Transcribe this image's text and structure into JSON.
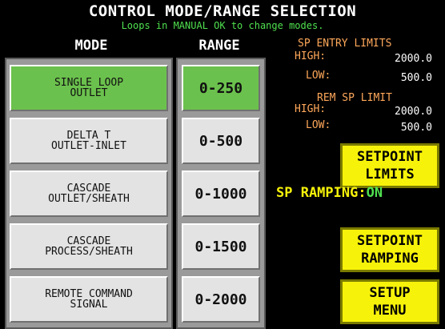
{
  "header": {
    "title": "CONTROL MODE/RANGE SELECTION",
    "subtitle": "Loops in MANUAL OK to change modes."
  },
  "columns": {
    "mode": "MODE",
    "range": "RANGE"
  },
  "modes": [
    {
      "label": "SINGLE LOOP\nOUTLET",
      "active": true
    },
    {
      "label": "DELTA T\nOUTLET-INLET",
      "active": false
    },
    {
      "label": "CASCADE\nOUTLET/SHEATH",
      "active": false
    },
    {
      "label": "CASCADE\nPROCESS/SHEATH",
      "active": false
    },
    {
      "label": "REMOTE COMMAND\nSIGNAL",
      "active": false
    }
  ],
  "ranges": [
    {
      "label": "0-250",
      "active": true
    },
    {
      "label": "0-500",
      "active": false
    },
    {
      "label": "0-1000",
      "active": false
    },
    {
      "label": "0-1500",
      "active": false
    },
    {
      "label": "0-2000",
      "active": false
    }
  ],
  "sp_entry_limits": {
    "title": "SP ENTRY LIMITS",
    "high_label": "HIGH:",
    "high_value": "2000.0",
    "low_label": "LOW:",
    "low_value": "500.0"
  },
  "rem_sp_limit": {
    "title": "REM SP LIMIT",
    "high_label": "HIGH:",
    "high_value": "2000.0",
    "low_label": "LOW:",
    "low_value": "500.0"
  },
  "buttons": {
    "setpoint_limits": "SETPOINT\nLIMITS",
    "setpoint_ramping": "SETPOINT\nRAMPING",
    "setup_menu": "SETUP\nMENU"
  },
  "sp_ramping": {
    "label": "SP RAMPING:",
    "state": "ON"
  },
  "colors": {
    "active_green": "#6bc14d",
    "button_yellow": "#f7f20a",
    "limit_orange": "#ffa85a",
    "status_green": "#4fe04f"
  }
}
